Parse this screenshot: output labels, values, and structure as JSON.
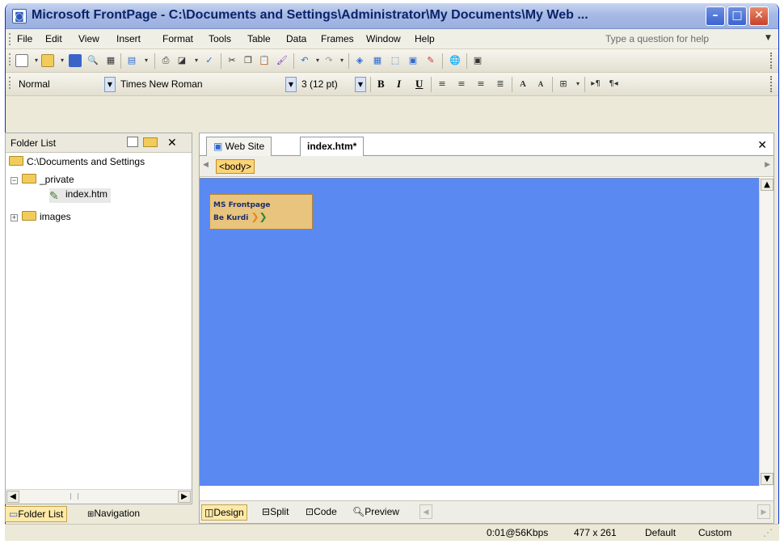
{
  "window": {
    "title": "Microsoft FrontPage - C:\\Documents and Settings\\Administrator\\My Documents\\My Web ..."
  },
  "menu": {
    "items": [
      "File",
      "Edit",
      "View",
      "Insert",
      "Format",
      "Tools",
      "Table",
      "Data",
      "Frames",
      "Window",
      "Help"
    ],
    "help_placeholder": "Type a question for help"
  },
  "format_toolbar": {
    "style": "Normal",
    "font": "Times New Roman",
    "size": "3 (12 pt)",
    "bold": "B",
    "italic": "I",
    "underline": "U"
  },
  "folder_panel": {
    "title": "Folder List",
    "root": "C:\\Documents and Settings",
    "private_folder": "_private",
    "file": "index.htm",
    "images_folder": "images",
    "tabs": [
      "Folder List",
      "Navigation"
    ]
  },
  "editor": {
    "tabs": [
      "Web Site",
      "index.htm*"
    ],
    "tag": "<body>",
    "logo_line1": "MS Frontpage",
    "logo_line2": "Be Kurdi",
    "view_tabs": [
      "Design",
      "Split",
      "Code",
      "Preview"
    ],
    "background_color": "#5b89f2"
  },
  "status": {
    "speed": "0:01@56Kbps",
    "dimensions": "477 x 261",
    "mode": "Default",
    "css": "Custom"
  }
}
